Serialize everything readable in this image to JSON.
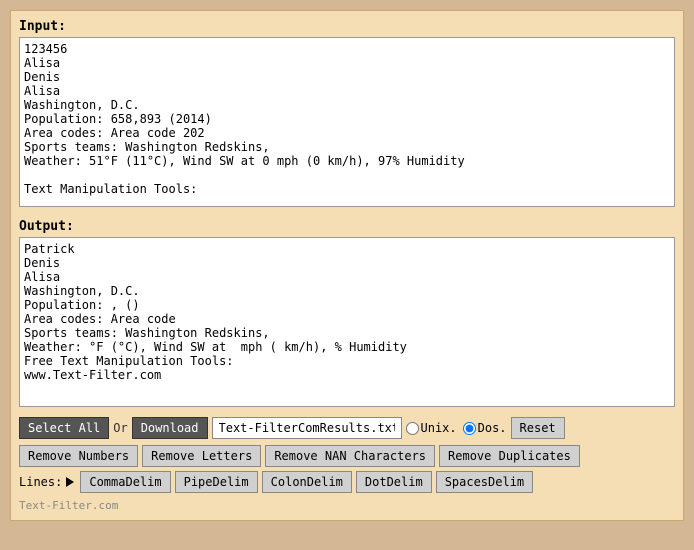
{
  "input": {
    "label": "Input:",
    "value": "123456\nAlisa\nDenis\nAlisa\nWashington, D.C.\nPopulation: 658,893 (2014)\nArea codes: Area code 202\nSports teams: Washington Redskins,\nWeather: 51°F (11°C), Wind SW at 0 mph (0 km/h), 97% Humidity\n\nText Manipulation Tools:"
  },
  "output": {
    "label": "Output:",
    "value": "Patrick\nDenis\nAlisa\nWashington, D.C.\nPopulation: , ()\nArea codes: Area code\nSports teams: Washington Redskins,\nWeather: °F (°C), Wind SW at  mph ( km/h), % Humidity\nFree Text Manipulation Tools:\nwww.Text-Filter.com"
  },
  "toolbar": {
    "select_all_label": "Select All",
    "or_label": "Or",
    "download_label": "Download",
    "filename_value": "Text-FilterComResults.txt",
    "unix_label": "Unix.",
    "dos_label": "Dos.",
    "reset_label": "Reset"
  },
  "action_buttons": {
    "remove_numbers_label": "Remove Numbers",
    "remove_letters_label": "Remove Letters",
    "remove_nan_label": "Remove NAN Characters",
    "remove_duplicates_label": "Remove Duplicates"
  },
  "lines_row": {
    "lines_label": "Lines:",
    "comma_delim_label": "CommaDelim",
    "pipe_delim_label": "PipeDelim",
    "colon_delim_label": "ColonDelim",
    "dot_delim_label": "DotDelim",
    "spaces_delim_label": "SpacesDelim"
  },
  "footer": {
    "text": "Text-Filter.com"
  }
}
